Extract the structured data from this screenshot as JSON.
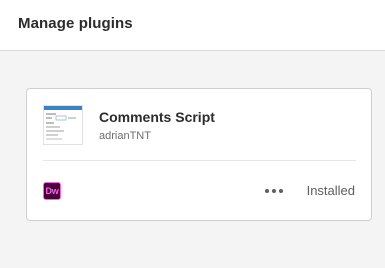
{
  "header": {
    "title": "Manage plugins"
  },
  "plugin": {
    "name": "Comments Script",
    "author": "adrianTNT",
    "host_app": {
      "abbr": "Dw",
      "colors": {
        "background": "#470137",
        "accent": "#ff61f6"
      }
    },
    "more_icon": "more-horizontal-icon",
    "status": "Installed"
  }
}
